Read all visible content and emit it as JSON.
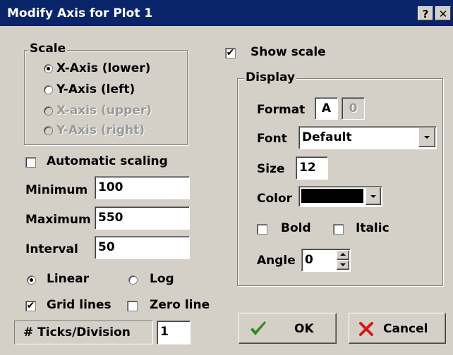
{
  "window": {
    "title": "Modify Axis for Plot 1",
    "help_label": "?",
    "close_label": "✕"
  },
  "scale_group": {
    "legend": "Scale",
    "options": [
      {
        "label": "X-Axis (lower)",
        "selected": true,
        "enabled": true
      },
      {
        "label": "Y-Axis (left)",
        "selected": false,
        "enabled": true
      },
      {
        "label": "X-axis (upper)",
        "selected": false,
        "enabled": false
      },
      {
        "label": "Y-Axis (right)",
        "selected": false,
        "enabled": false
      }
    ]
  },
  "automatic_scaling": {
    "label": "Automatic scaling",
    "checked": false
  },
  "minimum": {
    "label": "Minimum",
    "value": "100"
  },
  "maximum": {
    "label": "Maximum",
    "value": "550"
  },
  "interval": {
    "label": "Interval",
    "value": "50"
  },
  "scale_type": {
    "linear_label": "Linear",
    "log_label": "Log",
    "selected": "linear"
  },
  "grid_lines": {
    "label": "Grid lines",
    "checked": true
  },
  "zero_line": {
    "label": "Zero line",
    "checked": false
  },
  "ticks": {
    "label": "# Ticks/Division",
    "value": "1"
  },
  "show_scale": {
    "label": "Show scale",
    "checked": true
  },
  "display_group": {
    "legend": "Display",
    "format_label": "Format",
    "format_options": [
      "A",
      "0"
    ],
    "font_label": "Font",
    "font_value": "Default",
    "size_label": "Size",
    "size_value": "12",
    "color_label": "Color",
    "color_value": "#000000",
    "bold_label": "Bold",
    "italic_label": "Italic",
    "angle_label": "Angle",
    "angle_value": "0"
  },
  "buttons": {
    "ok_label": "OK",
    "cancel_label": "Cancel"
  },
  "colors": {
    "titlebar": "#0a246a",
    "dialog_bg": "#d4d0c8",
    "ok_check": "#2e8b1e",
    "cancel_x": "#d21a1a"
  }
}
